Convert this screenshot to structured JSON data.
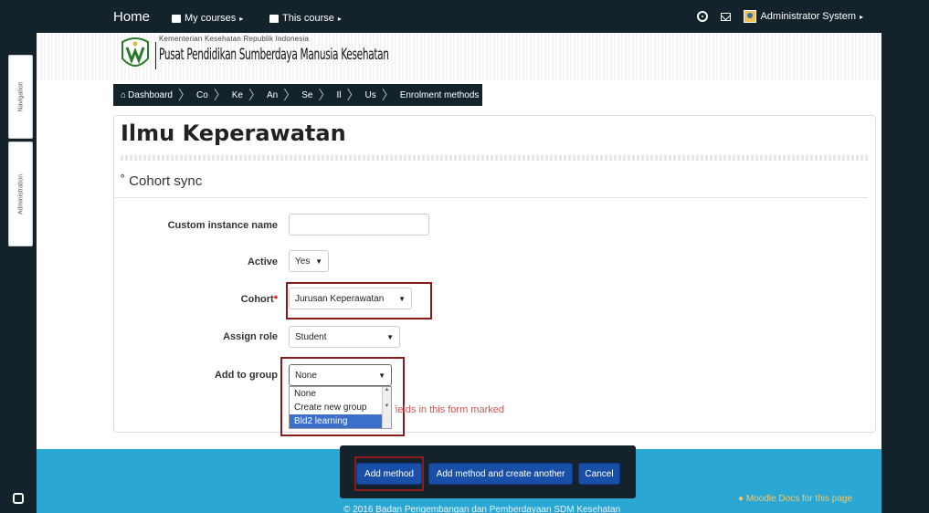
{
  "navbar": {
    "home": "Home",
    "my_courses": "My courses",
    "this_course": "This course",
    "user_name": "Administrator System"
  },
  "banner": {
    "subtitle": "Kementerian Kesehatan Republik Indonesia",
    "title": "Pusat Pendidikan Sumberdaya Manusia Kesehatan"
  },
  "drawer": {
    "navigation": "Navigation",
    "administration": "Administration"
  },
  "breadcrumb": [
    "Dashboard",
    "Co",
    "Ke",
    "An",
    "Se",
    "Il",
    "Us",
    "Enrolment methods"
  ],
  "page": {
    "title": "Ilmu Keperawatan",
    "section": "Cohort sync"
  },
  "form": {
    "custom_instance_name_label": "Custom instance name",
    "custom_instance_name_value": "",
    "active_label": "Active",
    "active_value": "Yes",
    "cohort_label": "Cohort",
    "cohort_value": "Jurusan Keperawatan",
    "assign_role_label": "Assign role",
    "assign_role_value": "Student",
    "add_to_group_label": "Add to group",
    "add_to_group_value": "None",
    "add_to_group_options": [
      "None",
      "Create new group",
      "Bld2 learning"
    ],
    "required_note": "There are required fields in this form marked *."
  },
  "buttons": {
    "add_method": "Add method",
    "add_method_and_create_another": "Add method and create another",
    "cancel": "Cancel"
  },
  "footer": {
    "copyright": "© 2016 Badan Pengembangan dan Pemberdayaan SDM Kesehatan",
    "docs_link": "Moodle Docs for this page"
  },
  "colors": {
    "navbar_bg": "#14222b",
    "footer_bg": "#2ba7d4",
    "button_blue": "#1a4fa8",
    "highlight_red": "#8b1a1a",
    "selected_option": "#3c6fc9"
  }
}
